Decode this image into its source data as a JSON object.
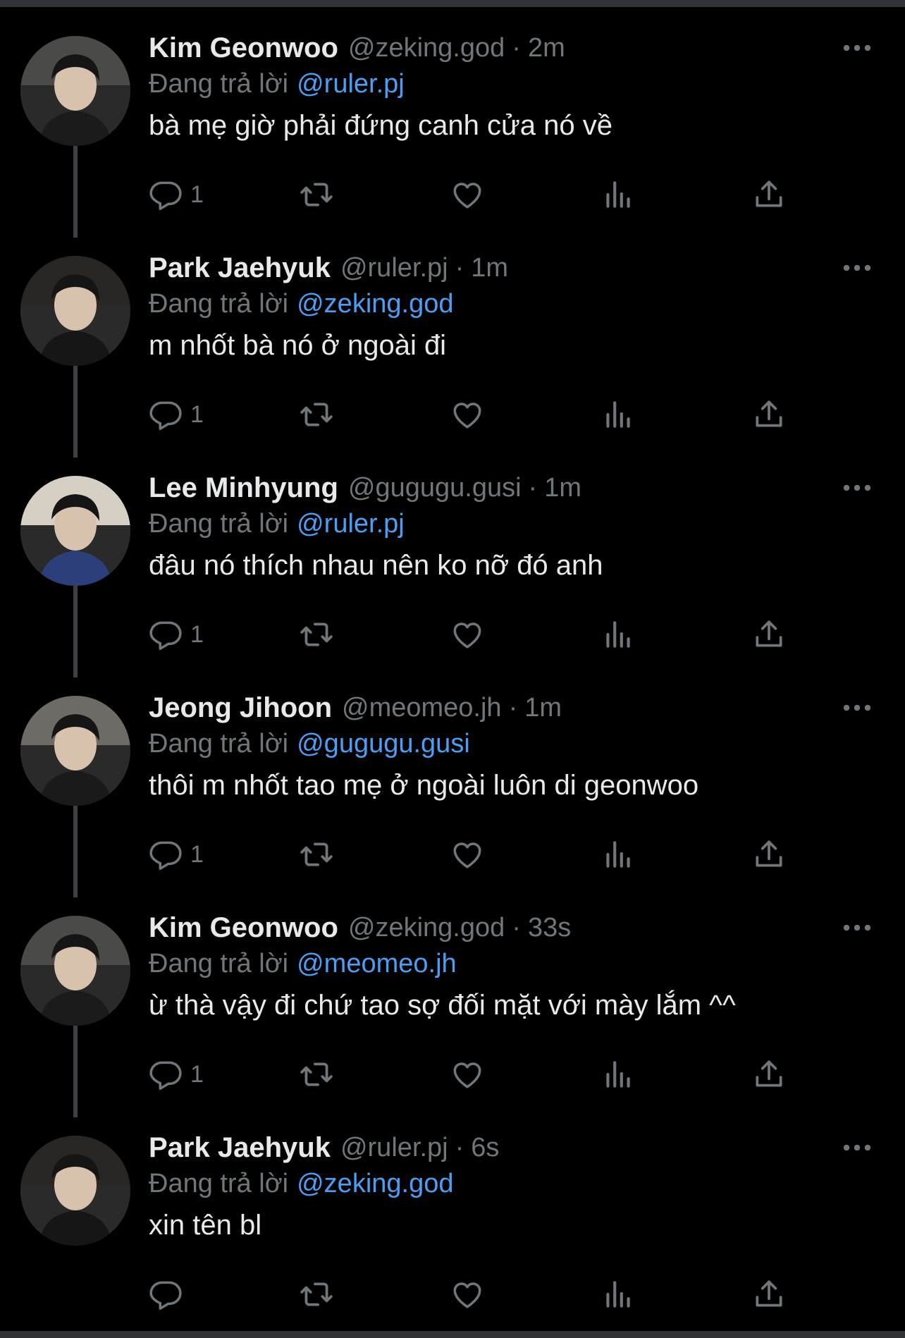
{
  "tweets": [
    {
      "name": "Kim Geonwoo",
      "handle": "@zeking.god",
      "time": "2m",
      "replying_label": "Đang trả lời",
      "replying_to": "@ruler.pj",
      "text": "bà mẹ giờ phải đứng canh cửa nó về",
      "reply_count": "1"
    },
    {
      "name": "Park Jaehyuk",
      "handle": "@ruler.pj",
      "time": "1m",
      "replying_label": "Đang trả lời",
      "replying_to": "@zeking.god",
      "text": "m nhốt bà nó ở ngoài đi",
      "reply_count": "1"
    },
    {
      "name": "Lee Minhyung",
      "handle": "@gugugu.gusi",
      "time": "1m",
      "replying_label": "Đang trả lời",
      "replying_to": "@ruler.pj",
      "text": "đâu nó thích nhau nên ko nỡ đó anh",
      "reply_count": "1"
    },
    {
      "name": "Jeong Jihoon",
      "handle": "@meomeo.jh",
      "time": "1m",
      "replying_label": "Đang trả lời",
      "replying_to": "@gugugu.gusi",
      "text": "thôi m nhốt tao mẹ ở ngoài luôn di geonwoo",
      "reply_count": "1"
    },
    {
      "name": "Kim Geonwoo",
      "handle": "@zeking.god",
      "time": "33s",
      "replying_label": "Đang trả lời",
      "replying_to": "@meomeo.jh",
      "text": "ừ thà vậy đi chứ tao sợ đối mặt với mày lắm ^^",
      "reply_count": "1"
    },
    {
      "name": "Park Jaehyuk",
      "handle": "@ruler.pj",
      "time": "6s",
      "replying_label": "Đang trả lời",
      "replying_to": "@zeking.god",
      "text": "xin tên bl",
      "reply_count": ""
    }
  ],
  "separator": "·",
  "icons": {
    "reply": "reply-icon",
    "retweet": "retweet-icon",
    "like": "heart-icon",
    "views": "views-icon",
    "share": "share-icon",
    "more": "more-icon"
  },
  "colors": {
    "background": "#000000",
    "text": "#e7e9ea",
    "secondary": "#71767b",
    "mention": "#4a9ff5"
  }
}
